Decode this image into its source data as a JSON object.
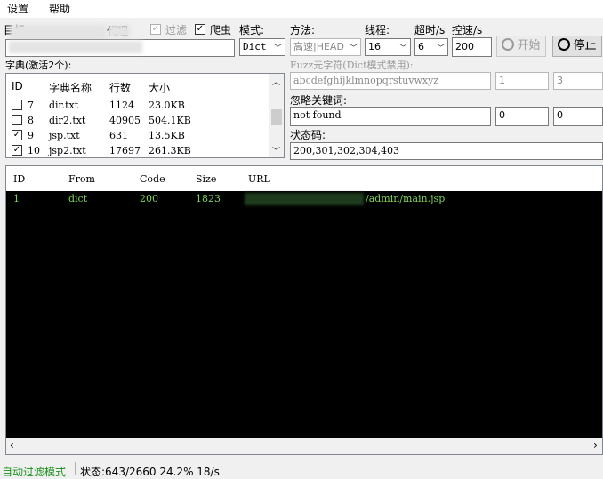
{
  "menu": {
    "settings": "设置",
    "help": "帮助"
  },
  "toolbar": {
    "target_label": "目标",
    "proxy_label": "代理",
    "filter_label": "过滤",
    "crawler_label": "爬虫",
    "filter_checked": true,
    "crawler_checked": true,
    "mode_label": "模式:",
    "mode_value": "Dict",
    "method_label": "方法:",
    "method_value": "高速|HEAD",
    "threads_label": "线程:",
    "threads_value": "16",
    "timeout_label": "超时/s",
    "timeout_value": "6",
    "rate_label": "控速/s",
    "rate_value": "200",
    "start_label": "开始",
    "stop_label": "停止"
  },
  "dict": {
    "label": "字典(激活2个):",
    "columns": [
      "ID",
      "字典名称",
      "行数",
      "大小"
    ],
    "rows": [
      {
        "checked": false,
        "id": "7",
        "name": "dir.txt",
        "lines": "1124",
        "size": "23.0KB"
      },
      {
        "checked": false,
        "id": "8",
        "name": "dir2.txt",
        "lines": "40905",
        "size": "504.1KB"
      },
      {
        "checked": true,
        "id": "9",
        "name": "jsp.txt",
        "lines": "631",
        "size": "13.5KB"
      },
      {
        "checked": true,
        "id": "10",
        "name": "jsp2.txt",
        "lines": "17697",
        "size": "261.3KB"
      }
    ]
  },
  "fuzz": {
    "label": "Fuzz元字符(Dict模式禁用):",
    "charset": "abcdefghijklmnopqrstuvwxyz",
    "min": "1",
    "max": "3"
  },
  "ignore": {
    "label": "忽略关键词:",
    "value": "not found",
    "v1": "0",
    "v2": "0"
  },
  "status_codes": {
    "label": "状态码:",
    "value": "200,301,302,304,403"
  },
  "results": {
    "columns": [
      "ID",
      "From",
      "Code",
      "Size",
      "URL"
    ],
    "rows": [
      {
        "id": "1",
        "from": "dict",
        "code": "200",
        "size": "1823",
        "url": "/admin/main.jsp"
      }
    ],
    "row_color": "#7cd657"
  },
  "statusbar": {
    "mode": "自动过滤模式",
    "progress": "状态:643/2660 24.2% 18/s"
  },
  "colors": {
    "bg": "#f0f0f0",
    "results_bg": "#000000",
    "results_text": "#7cd657",
    "status_mode": "#1a8f1a"
  }
}
